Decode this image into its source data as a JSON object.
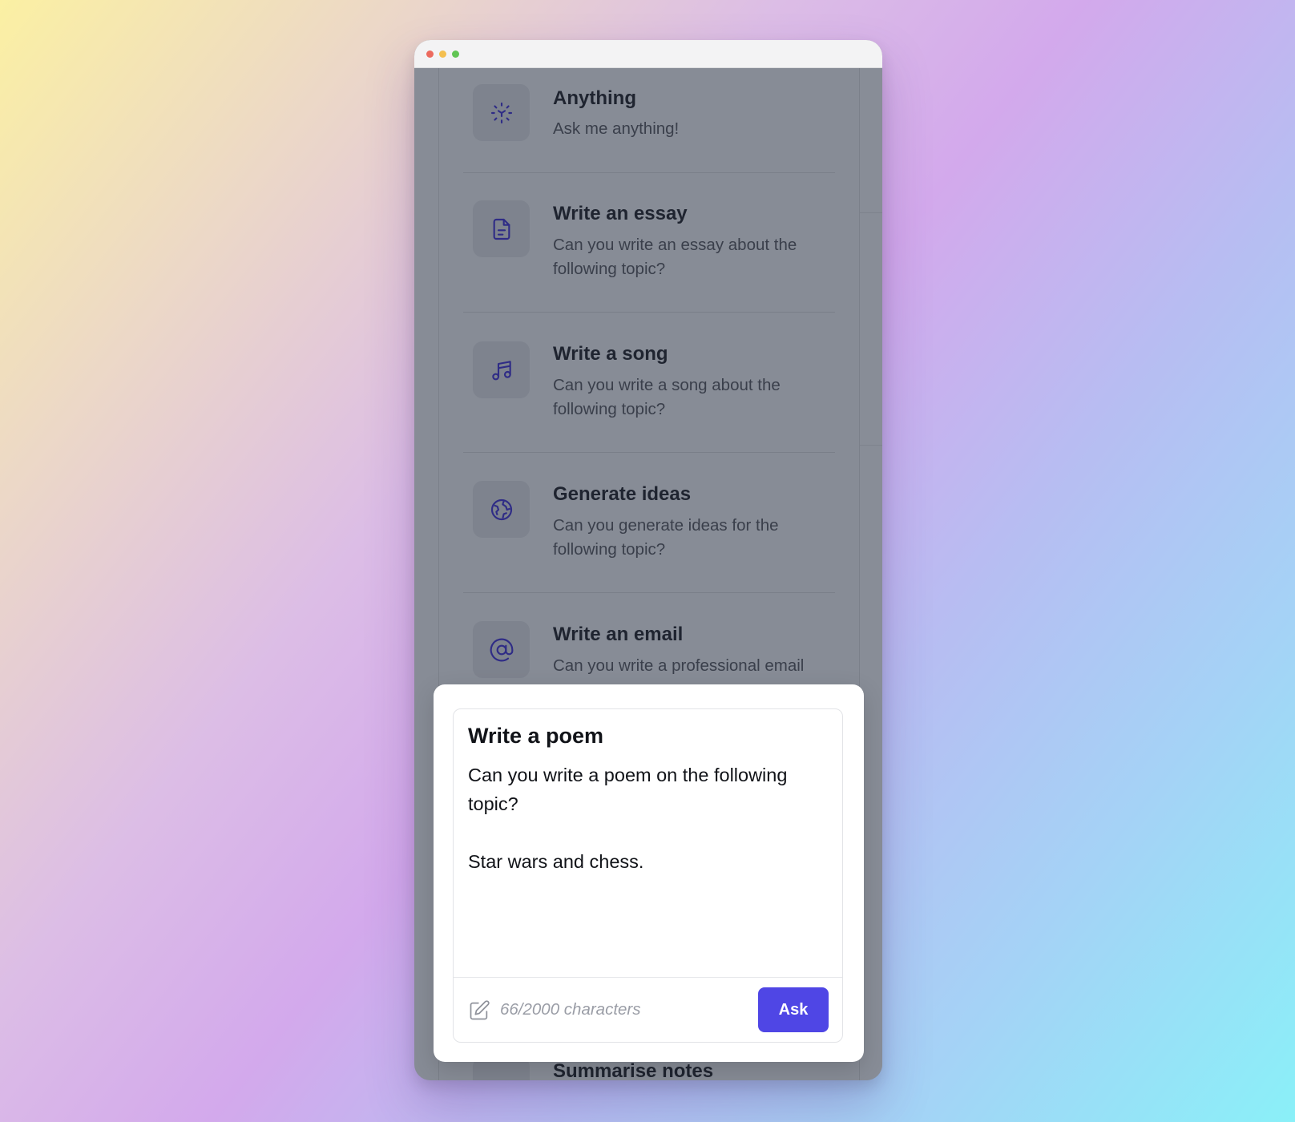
{
  "window": {
    "controls": [
      "close",
      "minimize",
      "maximize"
    ]
  },
  "prompts": [
    {
      "icon": "face-scan-icon",
      "title": "Anything",
      "description": "Ask me anything!"
    },
    {
      "icon": "document-icon",
      "title": "Write an essay",
      "description": "Can you write an essay about the following topic?"
    },
    {
      "icon": "music-note-icon",
      "title": "Write a song",
      "description": "Can you write a song about the following topic?"
    },
    {
      "icon": "globe-icon",
      "title": "Generate ideas",
      "description": "Can you generate ideas for the following topic?"
    },
    {
      "icon": "at-sign-icon",
      "title": "Write an email",
      "description": "Can you write a professional email"
    },
    {
      "icon": "notes-icon",
      "title": "Summarise notes",
      "description": ""
    }
  ],
  "modal": {
    "title": "Write a poem",
    "text": "Can you write a poem on the following topic?\n\nStar wars and chess.",
    "char_count": "66/2000 characters",
    "ask_label": "Ask"
  },
  "colors": {
    "accent": "#4f46e5",
    "icon": "#2f2c86",
    "overlay": "#878c96"
  }
}
